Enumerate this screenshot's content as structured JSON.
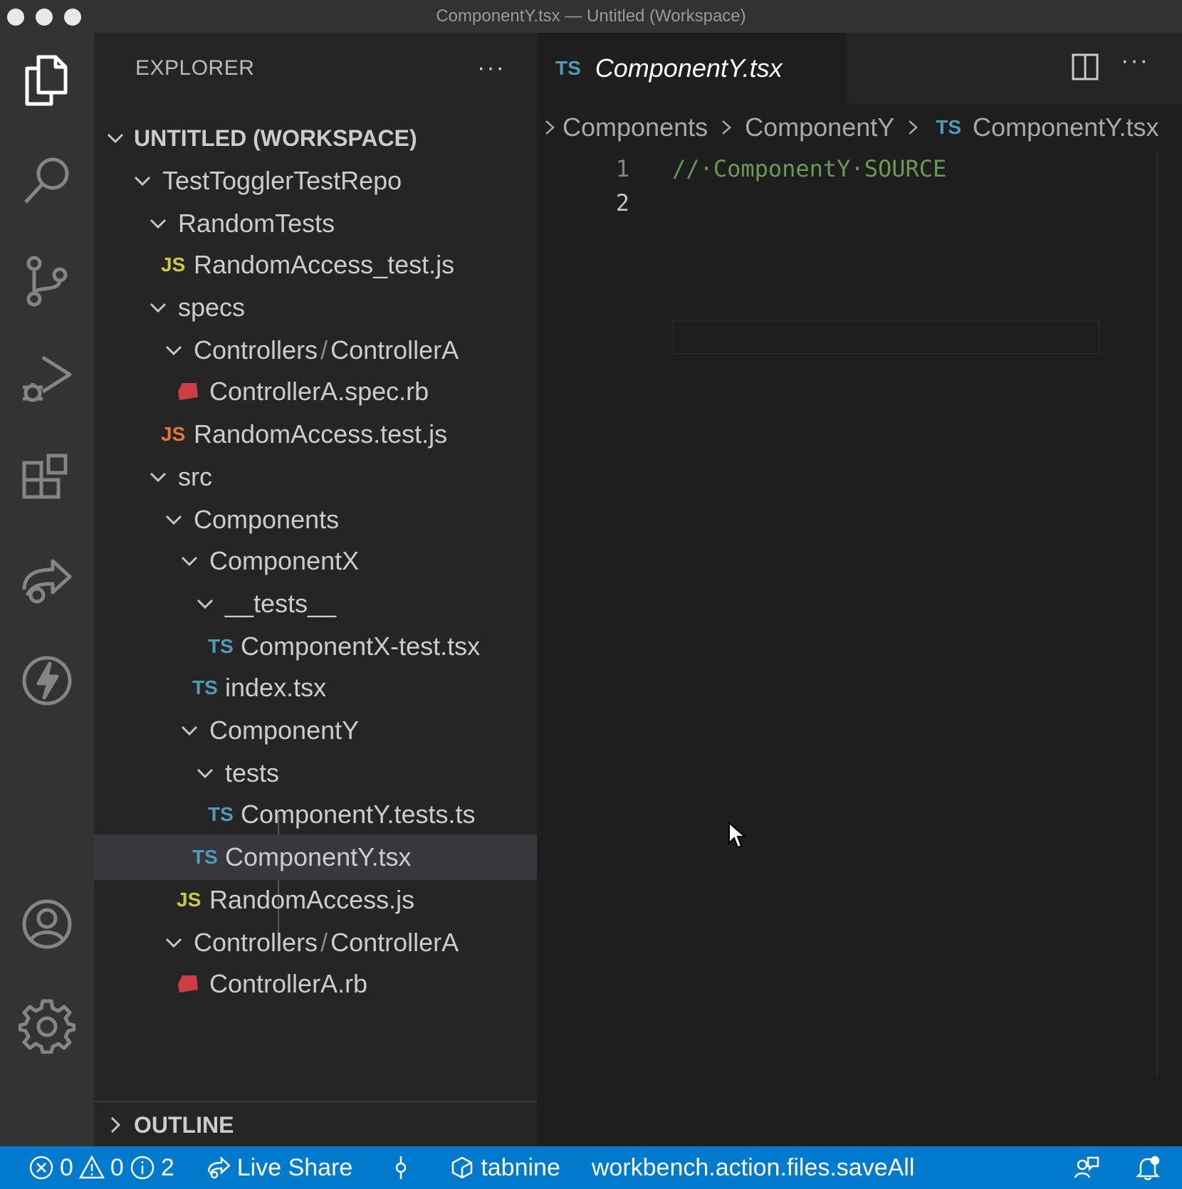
{
  "window": {
    "title": "ComponentY.tsx — Untitled (Workspace)"
  },
  "activity_bar": {
    "items": [
      "explorer-icon",
      "search-icon",
      "source-control-icon",
      "run-debug-icon",
      "extensions-icon",
      "live-share-icon",
      "lightning-icon",
      "account-icon",
      "settings-gear-icon"
    ]
  },
  "sidebar": {
    "header": "EXPLORER",
    "more": "···",
    "workspace": "UNTITLED (WORKSPACE)",
    "tree": [
      {
        "label": "TestTogglerTestRepo"
      },
      {
        "label": "RandomTests"
      },
      {
        "label": "RandomAccess_test.js",
        "icon": "JS"
      },
      {
        "label": "specs"
      },
      {
        "label_a": "Controllers",
        "label_b": "ControllerA"
      },
      {
        "label": "ControllerA.spec.rb"
      },
      {
        "label": "RandomAccess.test.js",
        "icon": "JS"
      },
      {
        "label": "src"
      },
      {
        "label": "Components"
      },
      {
        "label": "ComponentX"
      },
      {
        "label": "__tests__"
      },
      {
        "label": "ComponentX-test.tsx",
        "icon": "TS"
      },
      {
        "label": "index.tsx",
        "icon": "TS"
      },
      {
        "label": "ComponentY"
      },
      {
        "label": "tests"
      },
      {
        "label": "ComponentY.tests.ts",
        "icon": "TS"
      },
      {
        "label": "ComponentY.tsx",
        "icon": "TS"
      },
      {
        "label": "RandomAccess.js",
        "icon": "JS"
      },
      {
        "label_a": "Controllers",
        "label_b": "ControllerA"
      },
      {
        "label": "ControllerA.rb"
      }
    ],
    "separator": "/",
    "outline": "OUTLINE"
  },
  "editor": {
    "tab": {
      "icon": "TS",
      "name": "ComponentY.tsx"
    },
    "breadcrumbs": [
      "Components",
      "ComponentY",
      "ComponentY.tsx"
    ],
    "breadcrumb_icon": "TS",
    "lines": [
      {
        "number": "1",
        "text": "//·ComponentY·SOURCE"
      },
      {
        "number": "2",
        "text": ""
      }
    ]
  },
  "statusbar": {
    "errors": "0",
    "warnings": "0",
    "info": "2",
    "live_share": "Live Share",
    "tabnine": "tabnine",
    "command": "workbench.action.files.saveAll"
  },
  "colors": {
    "statusbar": "#007acc",
    "ts_icon": "#519aba",
    "js_icon": "#cbcb41",
    "js_alt_icon": "#e37933",
    "ruby_icon": "#cc3e44",
    "comment": "#6a9955"
  }
}
